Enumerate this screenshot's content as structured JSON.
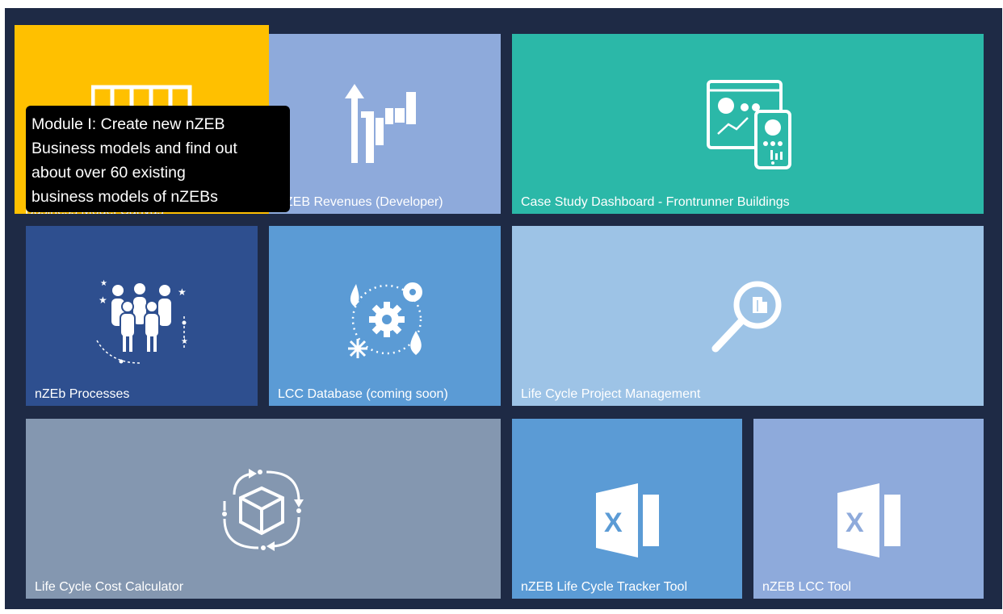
{
  "tiles": [
    {
      "label": "Business Model Canvas",
      "color": "#ffc000",
      "icon": "business-canvas-icon"
    },
    {
      "label": "nZEB Revenues (Developer)",
      "color": "#8eaadb",
      "icon": "revenue-chart-icon"
    },
    {
      "label": "Case Study Dashboard - Frontrunner Buildings",
      "color": "#2bb8a8",
      "icon": "dashboard-devices-icon"
    },
    {
      "label": "nZEb Processes",
      "color": "#2e4f8f",
      "icon": "people-group-icon"
    },
    {
      "label": "LCC Database (coming soon)",
      "color": "#5b9bd5",
      "icon": "energy-cycle-icon"
    },
    {
      "label": "Life Cycle Project Management",
      "color": "#9dc3e6",
      "icon": "magnifier-building-icon"
    },
    {
      "label": "Life Cycle Cost Calculator",
      "color": "#8497b0",
      "icon": "cube-cycle-icon"
    },
    {
      "label": "nZEB Life Cycle Tracker Tool",
      "color": "#5b9bd5",
      "icon": "excel-icon"
    },
    {
      "label": "nZEB LCC Tool",
      "color": "#8eaadb",
      "icon": "excel-icon"
    }
  ],
  "tooltip": {
    "lines": [
      "Module I: Create new nZEB",
      "Business models and find out",
      "about over 60 existing",
      "business models of nZEBs"
    ]
  },
  "colors": {
    "background": "#1e2a45",
    "tooltip_bg": "#000000",
    "icon": "#ffffff"
  }
}
